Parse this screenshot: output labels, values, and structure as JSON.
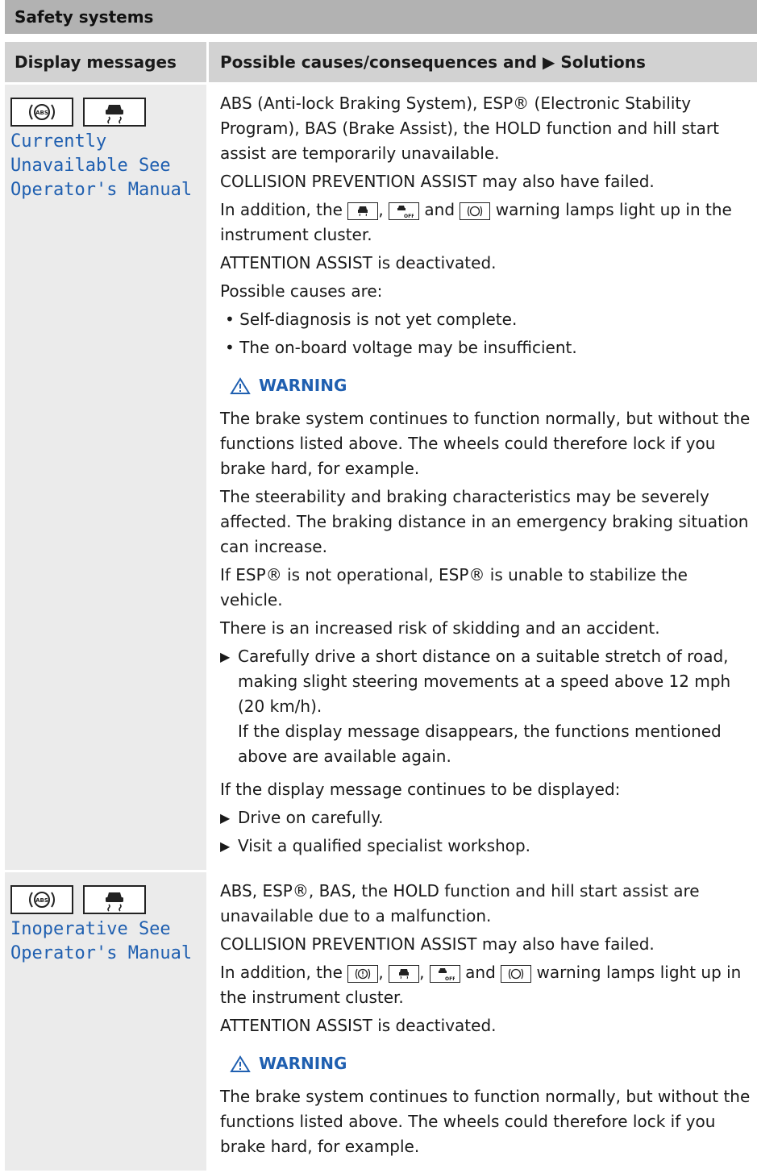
{
  "section": {
    "title": "Safety systems"
  },
  "table": {
    "col1": "Display messages",
    "col2": "Possible causes/consequences and ▶ Solutions",
    "rows": [
      {
        "display": "Currently\nUnavailable See\nOperator's Manual",
        "icons": [
          "abs-icon",
          "esp-skid-icon"
        ],
        "p1": "ABS (Anti-lock Braking System), ESP® (Electronic Stability Program), BAS (Brake Assist), the HOLD function and hill start assist are temporarily unavailable.",
        "p2": "COLLISION PREVENTION ASSIST may also have failed.",
        "p3_a": "In addition, the",
        "p3_b": ",",
        "p3_c": "and",
        "p3_d": "warning lamps light up in the instrument cluster.",
        "p4": "ATTENTION ASSIST is deactivated.",
        "p5": "Possible causes are:",
        "bullets": [
          "• Self-diagnosis is not yet complete.",
          "• The on-board voltage may be insufficient."
        ],
        "warning_label": "WARNING",
        "w1": "The brake system continues to function normally, but without the functions listed above. The wheels could therefore lock if you brake hard, for example.",
        "w2": "The steerability and braking characteristics may be severely affected. The braking distance in an emergency braking situation can increase.",
        "w3": "If ESP® is not operational, ESP® is unable to stabilize the vehicle.",
        "w4": "There is an increased risk of skidding and an accident.",
        "step1": "Carefully drive a short distance on a suitable stretch of road, making slight steering movements at a speed above 12 mph (20 km/h).",
        "step1b": "If the display message disappears, the functions mentioned above are available again.",
        "p6": "If the display message continues to be displayed:",
        "step2": "Drive on carefully.",
        "step3": "Visit a qualified specialist workshop."
      },
      {
        "display": "Inoperative See\nOperator's Manual",
        "icons": [
          "abs-icon",
          "esp-skid-icon"
        ],
        "p1": "ABS, ESP®, BAS, the HOLD function and hill start assist are unavailable due to a malfunction.",
        "p2": "COLLISION PREVENTION ASSIST may also have failed.",
        "p3_a": "In addition, the",
        "p3_b": ",",
        "p3_c": ",",
        "p3_d": "and",
        "p3_e": "warning lamps light up in the instrument cluster.",
        "p4": "ATTENTION ASSIST is deactivated.",
        "warning_label": "WARNING",
        "w1": "The brake system continues to function normally, but without the functions listed above. The wheels could therefore lock if you brake hard, for example."
      }
    ]
  },
  "colors": {
    "display_text": "#1f5fb0",
    "header_bg": "#d2d2d2",
    "section_bg": "#b2b2b2"
  }
}
